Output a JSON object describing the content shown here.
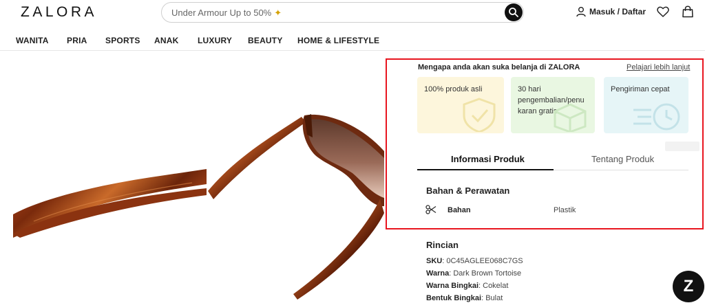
{
  "header": {
    "logo": "ZALORA",
    "search_placeholder": "Under Armour Up to 50%",
    "login_label": "Masuk / Daftar"
  },
  "nav": {
    "items": [
      "WANITA",
      "PRIA",
      "SPORTS",
      "ANAK",
      "LUXURY",
      "BEAUTY",
      "HOME & LIFESTYLE"
    ]
  },
  "why": {
    "title": "Mengapa anda akan suka belanja di ZALORA",
    "learn_more": "Pelajari lebih lanjut",
    "cards": [
      {
        "text": "100% produk asli",
        "color": "#fdf6dc",
        "icon": "shield-check-icon"
      },
      {
        "text": "30 hari pengembalian/penu karan gratis",
        "color": "#e9f7e2",
        "icon": "box-icon"
      },
      {
        "text": "Pengiriman cepat",
        "color": "#e6f5f7",
        "icon": "fast-clock-icon"
      }
    ]
  },
  "tabs": {
    "active": "Informasi Produk",
    "inactive": "Tentang Produk"
  },
  "material": {
    "section_title": "Bahan & Perawatan",
    "label": "Bahan",
    "value": "Plastik"
  },
  "details": {
    "section_title": "Rincian",
    "rows": [
      {
        "key": "SKU",
        "value": "0C45AGLEE068C7GS"
      },
      {
        "key": "Warna",
        "value": "Dark Brown Tortoise"
      },
      {
        "key": "Warna Bingkai",
        "value": "Cokelat"
      },
      {
        "key": "Bentuk Bingkai",
        "value": "Bulat"
      }
    ]
  },
  "chat_button": "Z",
  "colors": {
    "highlight": "#e8141e",
    "tortoise": "#8a3410",
    "lens": "#7a4a3a"
  }
}
